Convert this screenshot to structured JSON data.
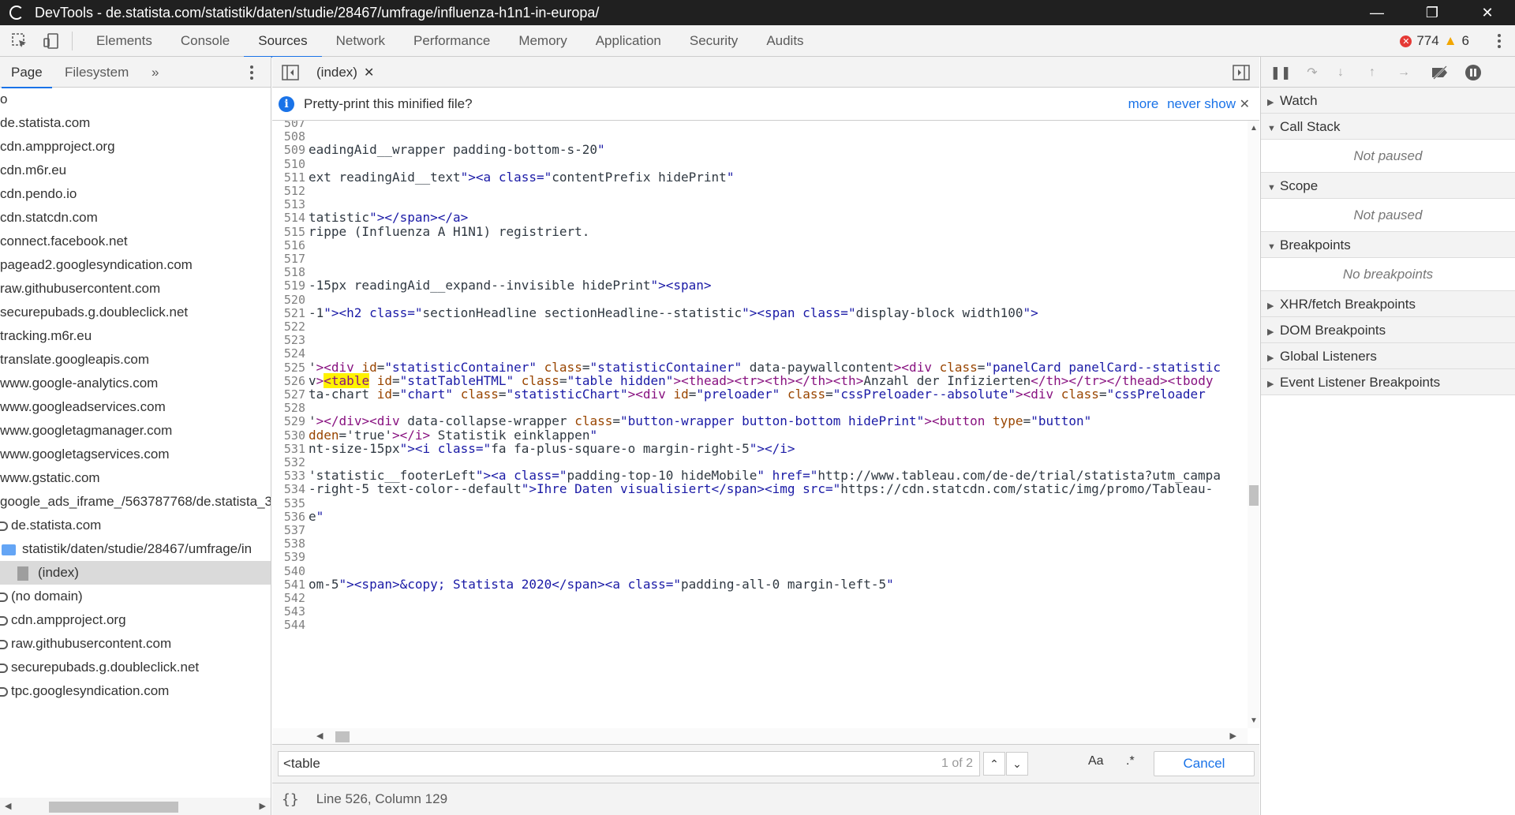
{
  "window": {
    "title": "DevTools - de.statista.com/statistik/daten/studie/28467/umfrage/influenza-h1n1-in-europa/"
  },
  "toolbar": {
    "tabs": [
      "Elements",
      "Console",
      "Sources",
      "Network",
      "Performance",
      "Memory",
      "Application",
      "Security",
      "Audits"
    ],
    "active_tab": "Sources",
    "error_count": "774",
    "warning_count": "6"
  },
  "navigator": {
    "tabs": [
      "Page",
      "Filesystem"
    ],
    "more": "»",
    "items": [
      {
        "label": "o",
        "type": "plain"
      },
      {
        "label": "de.statista.com",
        "type": "plain"
      },
      {
        "label": "cdn.ampproject.org",
        "type": "plain"
      },
      {
        "label": "cdn.m6r.eu",
        "type": "plain"
      },
      {
        "label": "cdn.pendo.io",
        "type": "plain"
      },
      {
        "label": "cdn.statcdn.com",
        "type": "plain"
      },
      {
        "label": "connect.facebook.net",
        "type": "plain"
      },
      {
        "label": "pagead2.googlesyndication.com",
        "type": "plain"
      },
      {
        "label": "raw.githubusercontent.com",
        "type": "plain"
      },
      {
        "label": "securepubads.g.doubleclick.net",
        "type": "plain"
      },
      {
        "label": "tracking.m6r.eu",
        "type": "plain"
      },
      {
        "label": "translate.googleapis.com",
        "type": "plain"
      },
      {
        "label": "www.google-analytics.com",
        "type": "plain"
      },
      {
        "label": "www.googleadservices.com",
        "type": "plain"
      },
      {
        "label": "www.googletagmanager.com",
        "type": "plain"
      },
      {
        "label": "www.googletagservices.com",
        "type": "plain"
      },
      {
        "label": "www.gstatic.com",
        "type": "plain"
      },
      {
        "label": "google_ads_iframe_/563787768/de.statista_3",
        "type": "plain"
      },
      {
        "label": "de.statista.com",
        "type": "domain"
      },
      {
        "label": "statistik/daten/studie/28467/umfrage/in",
        "type": "folder"
      },
      {
        "label": "(index)",
        "type": "file"
      },
      {
        "label": "(no domain)",
        "type": "domain"
      },
      {
        "label": "cdn.ampproject.org",
        "type": "domain"
      },
      {
        "label": "raw.githubusercontent.com",
        "type": "domain"
      },
      {
        "label": "securepubads.g.doubleclick.net",
        "type": "domain"
      },
      {
        "label": "tpc.googlesyndication.com",
        "type": "domain"
      }
    ]
  },
  "editor": {
    "tab_label": "(index)",
    "infobar_message": "Pretty-print this minified file?",
    "infobar_more": "more",
    "infobar_never": "never show",
    "lines": [
      {
        "n": "507",
        "code": ""
      },
      {
        "n": "508",
        "code": ""
      },
      {
        "n": "509",
        "code": "eadingAid__wrapper padding-bottom-s-20\""
      },
      {
        "n": "510",
        "code": ""
      },
      {
        "n": "511",
        "code": "ext readingAid__text\"><a class=\"contentPrefix hidePrint\""
      },
      {
        "n": "512",
        "code": ""
      },
      {
        "n": "513",
        "code": ""
      },
      {
        "n": "514",
        "code": "tatistic\"></span></a>"
      },
      {
        "n": "515",
        "code": "rippe (Influenza A H1N1) registriert."
      },
      {
        "n": "516",
        "code": ""
      },
      {
        "n": "517",
        "code": ""
      },
      {
        "n": "518",
        "code": ""
      },
      {
        "n": "519",
        "code": "-15px readingAid__expand--invisible hidePrint\"><span>"
      },
      {
        "n": "520",
        "code": ""
      },
      {
        "n": "521",
        "code": "-1\"><h2 class=\"sectionHeadline sectionHeadline--statistic\"><span class=\"display-block width100\">"
      },
      {
        "n": "522",
        "code": ""
      },
      {
        "n": "523",
        "code": ""
      },
      {
        "n": "524",
        "code": ""
      },
      {
        "n": "525",
        "code": "'><div id=\"statisticContainer\" class=\"statisticContainer\" data-paywallcontent><div class=\"panelCard panelCard--statistic"
      },
      {
        "n": "526",
        "code": "v><table id=\"statTableHTML\" class=\"table hidden\"><thead><tr><th></th><th>Anzahl der Infizierten</th></tr></thead><tbody"
      },
      {
        "n": "527",
        "code": "ta-chart id=\"chart\" class=\"statisticChart\"><div id=\"preloader\" class=\"cssPreloader--absolute\"><div class=\"cssPreloader"
      },
      {
        "n": "528",
        "code": ""
      },
      {
        "n": "529",
        "code": "'></div><div data-collapse-wrapper class=\"button-wrapper button-bottom hidePrint\"><button type=\"button\""
      },
      {
        "n": "530",
        "code": "dden='true'></i> Statistik einklappen\""
      },
      {
        "n": "531",
        "code": "nt-size-15px\"><i class=\"fa fa-plus-square-o margin-right-5\"></i>"
      },
      {
        "n": "532",
        "code": ""
      },
      {
        "n": "533",
        "code": "'statistic__footerLeft\"><a class=\"padding-top-10 hideMobile\" href=\"http://www.tableau.com/de-de/trial/statista?utm_campa"
      },
      {
        "n": "534",
        "code": "-right-5 text-color--default\">Ihre Daten visualisiert</span><img src=\"https://cdn.statcdn.com/static/img/promo/Tableau-"
      },
      {
        "n": "535",
        "code": ""
      },
      {
        "n": "536",
        "code": "e\""
      },
      {
        "n": "537",
        "code": ""
      },
      {
        "n": "538",
        "code": ""
      },
      {
        "n": "539",
        "code": ""
      },
      {
        "n": "540",
        "code": ""
      },
      {
        "n": "541",
        "code": "om-5\"><span>&copy; Statista 2020</span><a class=\"padding-all-0 margin-left-5\""
      },
      {
        "n": "542",
        "code": ""
      },
      {
        "n": "543",
        "code": ""
      },
      {
        "n": "544",
        "code": ""
      }
    ],
    "search_value": "<table",
    "search_count": "1 of 2",
    "match_case_label": "Aa",
    "regex_label": ".*",
    "cancel_label": "Cancel",
    "status_position": "Line 526, Column 129"
  },
  "debugger": {
    "panes": [
      {
        "title": "Watch",
        "expanded": false,
        "body": ""
      },
      {
        "title": "Call Stack",
        "expanded": true,
        "body": "Not paused"
      },
      {
        "title": "Scope",
        "expanded": true,
        "body": "Not paused"
      },
      {
        "title": "Breakpoints",
        "expanded": true,
        "body": "No breakpoints"
      },
      {
        "title": "XHR/fetch Breakpoints",
        "expanded": false,
        "body": ""
      },
      {
        "title": "DOM Breakpoints",
        "expanded": false,
        "body": ""
      },
      {
        "title": "Global Listeners",
        "expanded": false,
        "body": ""
      },
      {
        "title": "Event Listener Breakpoints",
        "expanded": false,
        "body": ""
      }
    ]
  },
  "colors": {
    "accent": "#1a73e8",
    "tag": "#881280",
    "attr_name": "#994500",
    "attr_value": "#1a1aa6",
    "highlight": "#fff200"
  }
}
